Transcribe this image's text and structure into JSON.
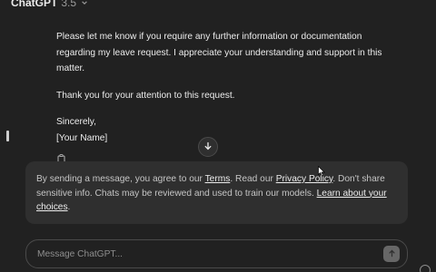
{
  "header": {
    "model_name": "ChatGPT",
    "model_version": "3.5"
  },
  "message": {
    "paragraph1": "Please let me know if you require any further information or documentation regarding my leave request. I appreciate your understanding and support in this matter.",
    "paragraph2": "Thank you for your attention to this request.",
    "closing": "Sincerely,",
    "name": "[Your Name]"
  },
  "notice": {
    "text1": "By sending a message, you agree to our ",
    "terms_link": "Terms",
    "text2": ". Read our ",
    "privacy_link": "Privacy Policy",
    "text3": ". Don't share sensitive info. Chats may be reviewed and used to train our models. ",
    "learn_link": "Learn about your choices",
    "text4": "."
  },
  "composer": {
    "placeholder": "Message ChatGPT..."
  },
  "icons": {
    "model_dropdown": "chevron-down-icon",
    "copy": "copy-icon",
    "scroll_down": "arrow-down-icon",
    "send": "arrow-up-icon",
    "help": "help-icon"
  }
}
